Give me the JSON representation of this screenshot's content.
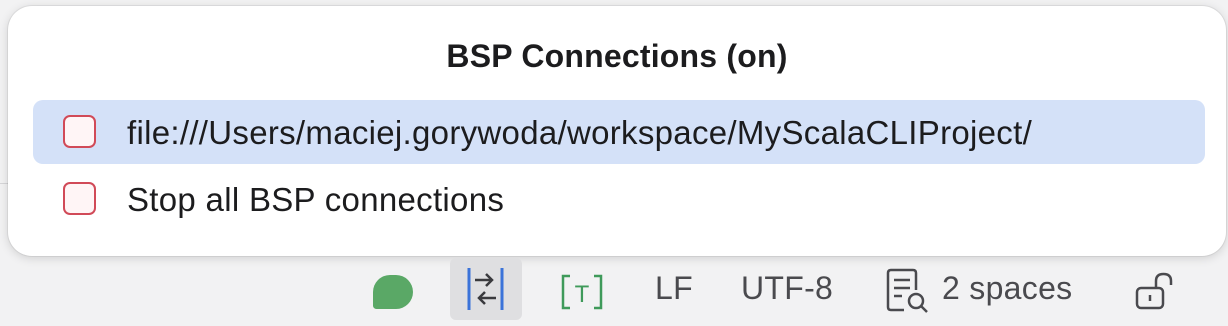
{
  "popup": {
    "title": "BSP Connections (on)",
    "items": [
      {
        "label": "file:///Users/maciej.gorywoda/workspace/MyScalaCLIProject/",
        "checked": false,
        "selected": true
      },
      {
        "label": "Stop all BSP connections",
        "checked": false,
        "selected": false
      }
    ]
  },
  "statusbar": {
    "status_indicator_icon": "green-status-icon",
    "indent_toggle_icon": "indent-arrows-icon",
    "text_mode_icon": "text-bracket-icon",
    "text_mode_glyph": "T",
    "line_separator": "LF",
    "encoding": "UTF-8",
    "indent_icon": "document-search-icon",
    "indent_label": "2 spaces",
    "lock_icon": "unlocked-icon"
  },
  "colors": {
    "selection": "#d4e1f8",
    "checkbox_border": "#d14a58",
    "status_green": "#5aa866",
    "accent_blue": "#3b73d9",
    "text_icon_green": "#3f9a5a"
  }
}
